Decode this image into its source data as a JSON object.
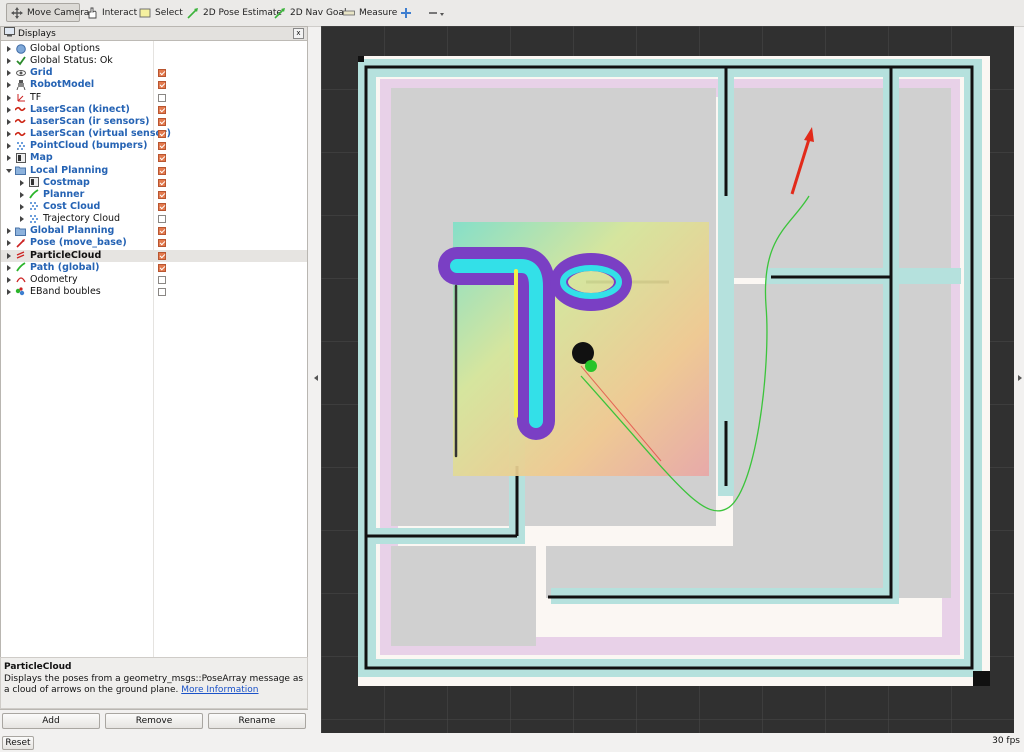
{
  "toolbar": {
    "items": [
      {
        "label": "Move Camera",
        "icon": "move-camera-icon",
        "active": true
      },
      {
        "label": "Interact",
        "icon": "hand-icon"
      },
      {
        "label": "Select",
        "icon": "select-icon"
      },
      {
        "label": "2D Pose Estimate",
        "icon": "pose-estimate-icon"
      },
      {
        "label": "2D Nav Goal",
        "icon": "nav-goal-icon"
      },
      {
        "label": "Measure",
        "icon": "ruler-icon"
      },
      {
        "label": "",
        "icon": "plus-icon"
      },
      {
        "label": "",
        "icon": "minus-dropdown-icon"
      }
    ]
  },
  "panel": {
    "title": "Displays",
    "close": "x",
    "items": [
      {
        "label": "Global Options",
        "icon": "globe-icon",
        "depth": 0,
        "style": "plain",
        "checkbox": null
      },
      {
        "label": "Global Status: Ok",
        "icon": "check-icon",
        "depth": 0,
        "style": "plain",
        "checkbox": null
      },
      {
        "label": "Grid",
        "icon": "grid-icon",
        "depth": 0,
        "style": "blue",
        "checkbox": true
      },
      {
        "label": "RobotModel",
        "icon": "robot-icon",
        "depth": 0,
        "style": "blue",
        "checkbox": true
      },
      {
        "label": "TF",
        "icon": "tf-icon",
        "depth": 0,
        "style": "plain",
        "checkbox": false
      },
      {
        "label": "LaserScan (kinect)",
        "icon": "laserscan-icon",
        "depth": 0,
        "style": "blue",
        "checkbox": true
      },
      {
        "label": "LaserScan (ir sensors)",
        "icon": "laserscan-icon",
        "depth": 0,
        "style": "blue",
        "checkbox": true
      },
      {
        "label": "LaserScan (virtual sensor)",
        "icon": "laserscan-icon",
        "depth": 0,
        "style": "blue",
        "checkbox": true
      },
      {
        "label": "PointCloud (bumpers)",
        "icon": "pointcloud-icon",
        "depth": 0,
        "style": "blue",
        "checkbox": true
      },
      {
        "label": "Map",
        "icon": "map-icon",
        "depth": 0,
        "style": "blue",
        "checkbox": true
      },
      {
        "label": "Local Planning",
        "icon": "folder-icon",
        "depth": 0,
        "style": "blue",
        "checkbox": true,
        "open": true
      },
      {
        "label": "Costmap",
        "icon": "map-icon",
        "depth": 1,
        "style": "blue",
        "checkbox": true
      },
      {
        "label": "Planner",
        "icon": "path-icon",
        "depth": 1,
        "style": "blue",
        "checkbox": true
      },
      {
        "label": "Cost Cloud",
        "icon": "pointcloud-icon",
        "depth": 1,
        "style": "blue",
        "checkbox": true
      },
      {
        "label": "Trajectory Cloud",
        "icon": "pointcloud-icon",
        "depth": 1,
        "style": "plain",
        "checkbox": false
      },
      {
        "label": "Global Planning",
        "icon": "folder-icon",
        "depth": 0,
        "style": "blue",
        "checkbox": true
      },
      {
        "label": "Pose (move_base)",
        "icon": "pose-icon",
        "depth": 0,
        "style": "blue",
        "checkbox": true
      },
      {
        "label": "ParticleCloud",
        "icon": "particlecloud-icon",
        "depth": 0,
        "style": "bold",
        "checkbox": true,
        "selected": true
      },
      {
        "label": "Path (global)",
        "icon": "path-icon",
        "depth": 0,
        "style": "blue",
        "checkbox": true
      },
      {
        "label": "Odometry",
        "icon": "odometry-icon",
        "depth": 0,
        "style": "plain",
        "checkbox": false
      },
      {
        "label": "EBand boubles",
        "icon": "eband-icon",
        "depth": 0,
        "style": "plain",
        "checkbox": false
      }
    ]
  },
  "description": {
    "title": "ParticleCloud",
    "text": "Displays the poses from a geometry_msgs::PoseArray message as a cloud of arrows on the ground plane.",
    "link": "More Information"
  },
  "buttons": {
    "add": "Add",
    "remove": "Remove",
    "rename": "Rename",
    "reset": "Reset"
  },
  "status": {
    "fps": "30 fps"
  },
  "colors": {
    "accent_checkbox": "#e37a4e",
    "blue_label": "#2563b4",
    "viewport_bg": "#303030"
  }
}
